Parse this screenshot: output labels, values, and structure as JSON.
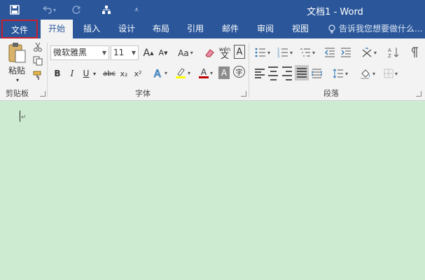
{
  "window": {
    "title": "文档1 - Word"
  },
  "tabs": [
    "文件",
    "开始",
    "插入",
    "设计",
    "布局",
    "引用",
    "邮件",
    "审阅",
    "视图"
  ],
  "tell_me": "告诉我您想要做什么...",
  "clipboard": {
    "paste_label": "粘贴",
    "group_label": "剪贴板"
  },
  "font": {
    "name": "微软雅黑",
    "size": "11",
    "group_label": "字体",
    "case_label": "Aa",
    "bold": "B",
    "italic": "I",
    "underline": "U",
    "strike": "abc",
    "subscript": "x₂",
    "superscript": "x²",
    "color_letter": "A",
    "char_border": "A",
    "grow": "A",
    "shrink": "A",
    "phonetic": "wén",
    "enclose": "字"
  },
  "paragraph": {
    "group_label": "段落"
  },
  "colors": {
    "titlebar": "#2b579a",
    "doc_bg": "#cdebd0",
    "highlight": "#ffff00",
    "font_color": "#c00000",
    "file_tab_border": "#c8202f"
  }
}
